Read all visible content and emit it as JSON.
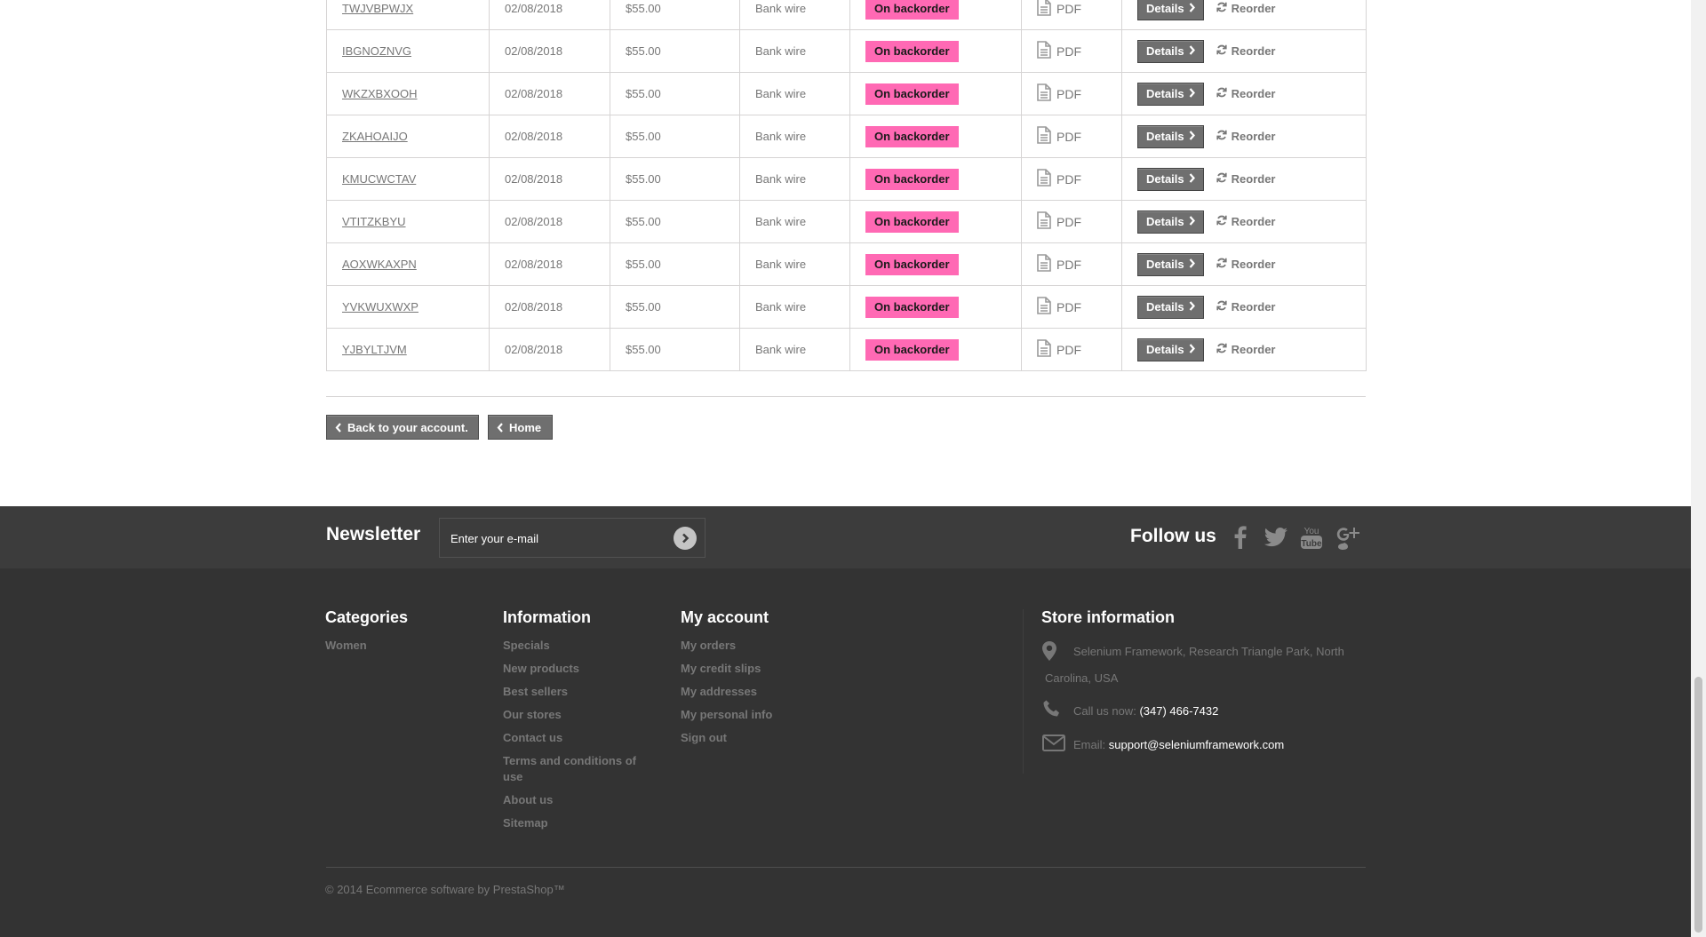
{
  "orders": [
    {
      "ref": "TWJVBPWJX",
      "date": "02/08/2018",
      "price": "$55.00",
      "payment": "Bank wire",
      "status": "On backorder",
      "pdf": "PDF",
      "details": "Details",
      "reorder": "Reorder"
    },
    {
      "ref": "IBGNOZNVG",
      "date": "02/08/2018",
      "price": "$55.00",
      "payment": "Bank wire",
      "status": "On backorder",
      "pdf": "PDF",
      "details": "Details",
      "reorder": "Reorder"
    },
    {
      "ref": "WKZXBXOOH",
      "date": "02/08/2018",
      "price": "$55.00",
      "payment": "Bank wire",
      "status": "On backorder",
      "pdf": "PDF",
      "details": "Details",
      "reorder": "Reorder"
    },
    {
      "ref": "ZKAHOAIJO",
      "date": "02/08/2018",
      "price": "$55.00",
      "payment": "Bank wire",
      "status": "On backorder",
      "pdf": "PDF",
      "details": "Details",
      "reorder": "Reorder"
    },
    {
      "ref": "KMUCWCTAV",
      "date": "02/08/2018",
      "price": "$55.00",
      "payment": "Bank wire",
      "status": "On backorder",
      "pdf": "PDF",
      "details": "Details",
      "reorder": "Reorder"
    },
    {
      "ref": "VTITZKBYU",
      "date": "02/08/2018",
      "price": "$55.00",
      "payment": "Bank wire",
      "status": "On backorder",
      "pdf": "PDF",
      "details": "Details",
      "reorder": "Reorder"
    },
    {
      "ref": "AOXWKAXPN",
      "date": "02/08/2018",
      "price": "$55.00",
      "payment": "Bank wire",
      "status": "On backorder",
      "pdf": "PDF",
      "details": "Details",
      "reorder": "Reorder"
    },
    {
      "ref": "YVKWUXWXP",
      "date": "02/08/2018",
      "price": "$55.00",
      "payment": "Bank wire",
      "status": "On backorder",
      "pdf": "PDF",
      "details": "Details",
      "reorder": "Reorder"
    },
    {
      "ref": "YJBYLTJVM",
      "date": "02/08/2018",
      "price": "$55.00",
      "payment": "Bank wire",
      "status": "On backorder",
      "pdf": "PDF",
      "details": "Details",
      "reorder": "Reorder"
    }
  ],
  "nav": {
    "back_label": "Back to your account.",
    "home_label": "Home"
  },
  "newsletter": {
    "title": "Newsletter",
    "placeholder": "Enter your e-mail"
  },
  "follow": {
    "title": "Follow us",
    "icons": [
      "facebook-icon",
      "twitter-icon",
      "youtube-icon",
      "google-plus-icon"
    ]
  },
  "footer": {
    "categories": {
      "title": "Categories",
      "items": [
        "Women"
      ]
    },
    "information": {
      "title": "Information",
      "items": [
        "Specials",
        "New products",
        "Best sellers",
        "Our stores",
        "Contact us",
        "Terms and conditions of use",
        "About us",
        "Sitemap"
      ]
    },
    "my_account": {
      "title": "My account",
      "items": [
        "My orders",
        "My credit slips",
        "My addresses",
        "My personal info",
        "Sign out"
      ]
    },
    "store": {
      "title": "Store information",
      "address": "Selenium Framework, Research Triangle Park, North Carolina, USA",
      "call_label": "Call us now:",
      "phone": "(347) 466-7432",
      "email_label": "Email:",
      "email": "support@seleniumframework.com"
    },
    "copyright": "© 2014 Ecommerce software by PrestaShop™"
  },
  "colors": {
    "status_badge": "#ff69b4",
    "button": "#6f6f6f",
    "footer_bg": "#333333",
    "newsletter_bg": "#3c3c3c"
  }
}
